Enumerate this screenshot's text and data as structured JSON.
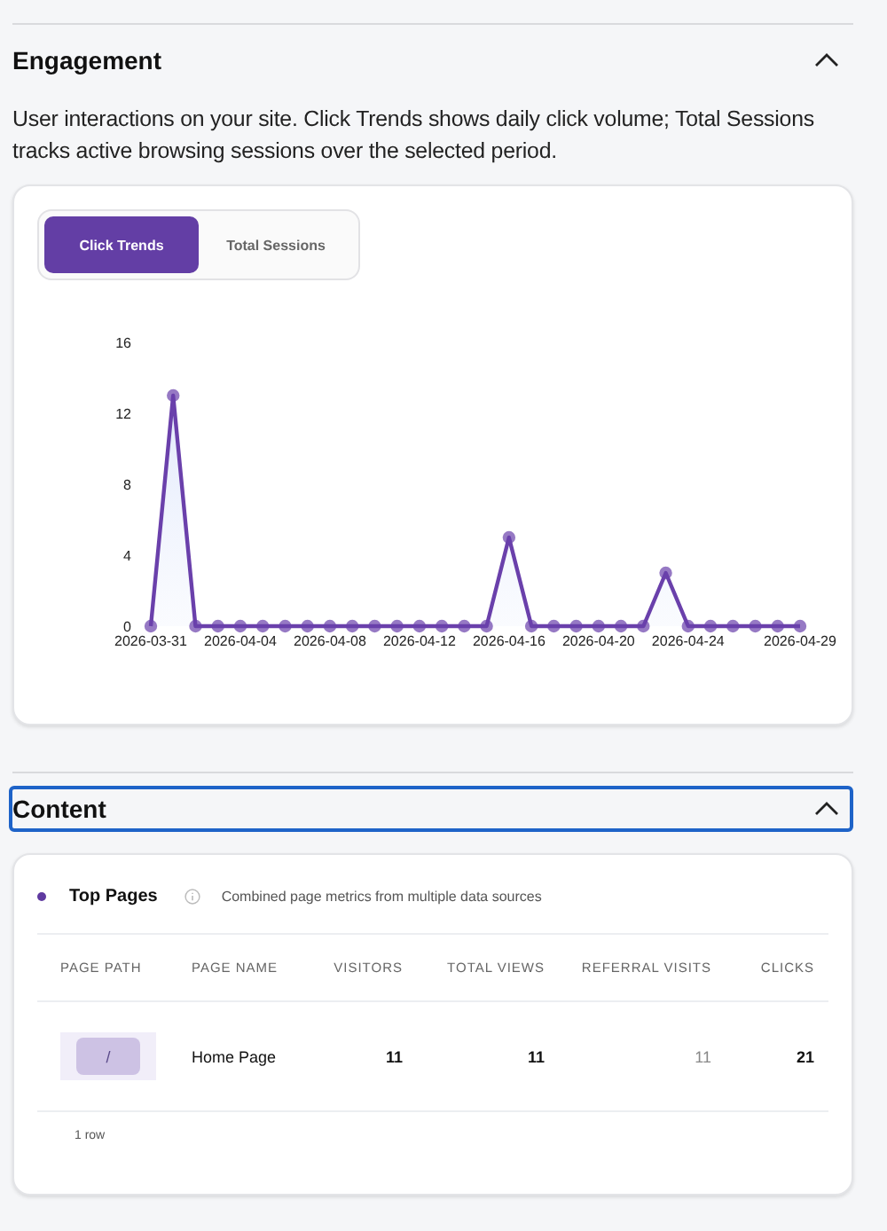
{
  "sections": [
    {
      "kind": "chart",
      "title": "Engagement",
      "expanded": true,
      "focused": false,
      "description": "User interactions on your site. Click Trends shows daily click volume; Total Sessions tracks active browsing sessions over the selected period.",
      "tabs": [
        {
          "label": "Click Trends",
          "selected": true
        },
        {
          "label": "Total Sessions",
          "selected": false
        }
      ],
      "chart_data": {
        "type": "area",
        "categories": [
          "2026-03-31",
          null,
          null,
          null,
          "2026-04-04",
          null,
          null,
          null,
          "2026-04-08",
          null,
          null,
          null,
          "2026-04-12",
          null,
          null,
          null,
          "2026-04-16",
          null,
          null,
          null,
          "2026-04-20",
          null,
          null,
          null,
          "2026-04-24",
          null,
          null,
          null,
          null,
          "2026-04-29"
        ],
        "series": [
          {
            "color": "#6a40ab",
            "values": [
              0,
              13,
              0,
              0,
              0,
              0,
              0,
              0,
              0,
              0,
              0,
              0,
              0,
              0,
              0,
              0,
              5,
              0,
              0,
              0,
              0,
              0,
              0,
              3,
              0,
              0,
              0,
              0,
              0,
              0
            ]
          }
        ],
        "ylim": [
          0,
          16
        ],
        "yticks": [
          0,
          4,
          8,
          12,
          16
        ]
      }
    },
    {
      "kind": "table",
      "title": "Content",
      "expanded": true,
      "focused": true,
      "panel": {
        "title": "Top Pages",
        "subtitle": "Combined page metrics from multiple data sources",
        "columns": [
          "PAGE PATH",
          "PAGE NAME",
          "VISITORS",
          "TOTAL VIEWS",
          "REFERRAL VISITS",
          "CLICKS"
        ],
        "rows": [
          [
            "/",
            "Home Page",
            "11",
            "11",
            "11",
            "21"
          ]
        ],
        "footer": "1 row"
      }
    }
  ]
}
